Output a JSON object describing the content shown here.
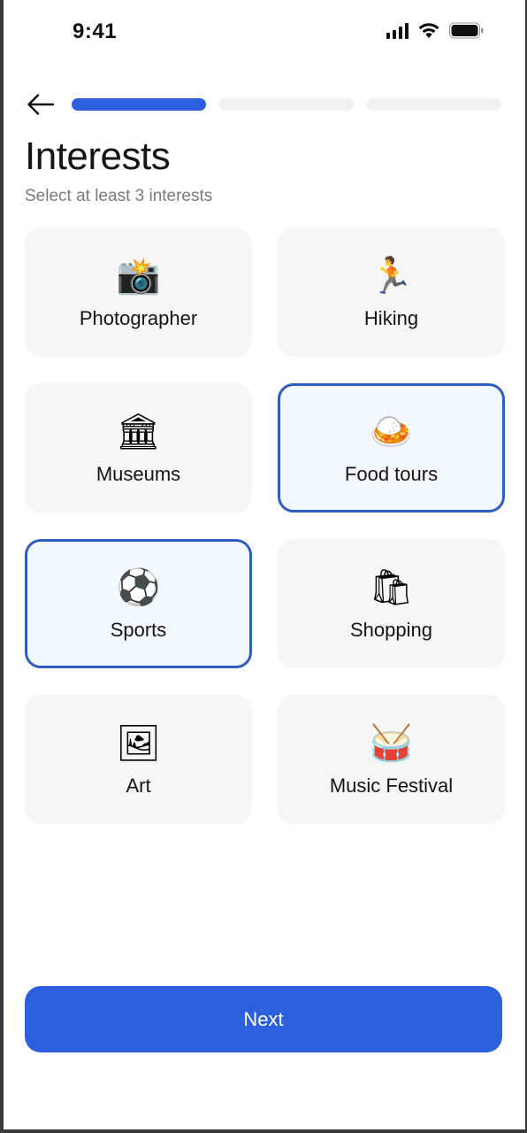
{
  "status_bar": {
    "time": "9:41",
    "icons": [
      "signal-icon",
      "wifi-icon",
      "battery-icon"
    ]
  },
  "header": {
    "back_icon": "arrow-left-icon",
    "progress": {
      "total_steps": 3,
      "current_step": 1
    },
    "title": "Interests",
    "subtitle": "Select at least 3 interests"
  },
  "interests": [
    {
      "label": "Photographer",
      "icon": "📸",
      "icon_name": "camera-flash-icon",
      "selected": false
    },
    {
      "label": "Hiking",
      "icon": "🏃",
      "icon_name": "runner-icon",
      "selected": false
    },
    {
      "label": "Museums",
      "icon": "🏛",
      "icon_name": "classical-building-icon",
      "selected": false
    },
    {
      "label": "Food tours",
      "icon": "🍛",
      "icon_name": "curry-rice-icon",
      "selected": true
    },
    {
      "label": "Sports",
      "icon": "⚽",
      "icon_name": "soccer-ball-icon",
      "selected": true
    },
    {
      "label": "Shopping",
      "icon": "🛍",
      "icon_name": "shopping-bags-icon",
      "selected": false
    },
    {
      "label": "Art",
      "icon": "🖼",
      "icon_name": "framed-picture-icon",
      "selected": false
    },
    {
      "label": "Music Festival",
      "icon": "🥁",
      "icon_name": "drum-icon",
      "selected": false
    }
  ],
  "footer": {
    "next_label": "Next"
  },
  "colors": {
    "accent": "#2c5fde",
    "selected_border": "#2f5cc2",
    "selected_bg": "#f3f7fe",
    "card_bg": "#f6f6f6",
    "track": "#f1f1f1"
  }
}
